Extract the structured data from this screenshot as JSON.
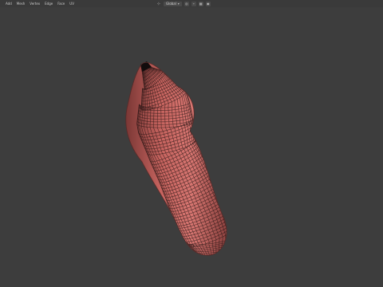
{
  "header": {
    "menu": [
      "Add",
      "Mesh",
      "Vertex",
      "Edge",
      "Face",
      "UV"
    ],
    "transform_orientation": "Global",
    "icons": {
      "orientation": "axes-icon",
      "pivot": "pivot-point-icon",
      "snap": "snap-magnet-icon",
      "snap_target": "snap-grid-icon",
      "proportional": "proportional-edit-icon"
    }
  },
  "viewport": {
    "object": "sculpt-mesh",
    "colors": {
      "background": "#3d3d3d",
      "mesh_face": "#c7645f",
      "mesh_wire": "#1a0f0f"
    }
  }
}
